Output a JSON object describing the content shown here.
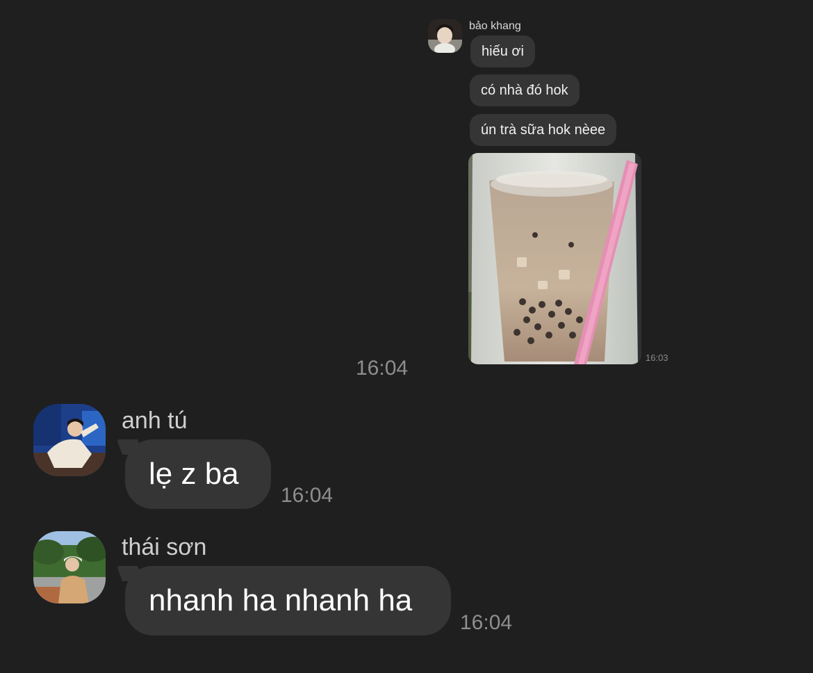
{
  "chat": {
    "first_sender": {
      "name": "bảo khang",
      "messages": [
        "hiếu ơi",
        "có nhà đó hok",
        "ún trà sữa hok nèee"
      ],
      "image_time": "16:03"
    },
    "separator_time": "16:04",
    "messages": [
      {
        "sender": "anh tú",
        "text": "lẹ z ba",
        "time": "16:04"
      },
      {
        "sender": "thái sơn",
        "text": "nhanh ha nhanh ha",
        "time": "16:04"
      }
    ]
  },
  "colors": {
    "background": "#1f1f20",
    "bubble": "#353536",
    "timestamp": "#8e8e8e"
  },
  "icons": {
    "avatar_bao_khang": "avatar-photo",
    "avatar_anh_tu": "avatar-photo",
    "avatar_thai_son": "avatar-photo",
    "shared_image": "milk-tea-photo"
  }
}
